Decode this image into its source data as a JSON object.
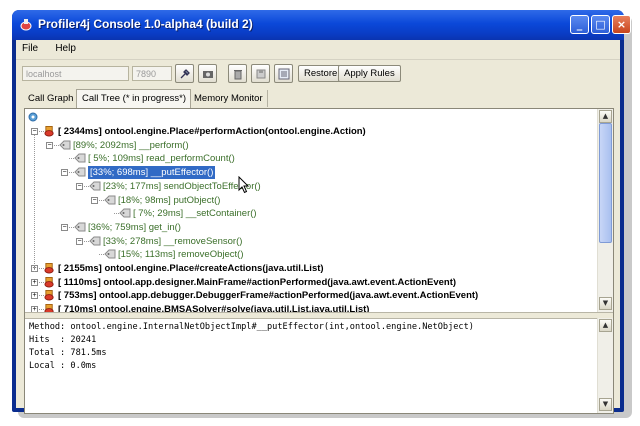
{
  "window": {
    "title": "Profiler4j Console 1.0-alpha4 (build 2)",
    "minimize": "_",
    "maximize": "□",
    "close": "×"
  },
  "menu": [
    "File",
    "Help"
  ],
  "toolbar": {
    "host_placeholder": "localhost",
    "port_placeholder": "7890",
    "restore_label": "Restore",
    "apply_rules_label": "Apply Rules"
  },
  "tabs": [
    {
      "label": "Call Graph",
      "active": false
    },
    {
      "label": "Call Tree (* in progress*)",
      "active": true
    },
    {
      "label": "Memory Monitor",
      "active": false
    }
  ],
  "tree": [
    {
      "depth": 0,
      "icon": "method-icon",
      "text": "[  2344ms] ontool.engine.Place#performAction(ontool.engine.Action)",
      "style": "bold"
    },
    {
      "depth": 1,
      "icon": "method-icon",
      "text": "[89%;   2092ms] __perform()",
      "style": "green"
    },
    {
      "depth": 2,
      "icon": "method-icon",
      "text": "[ 5%;   109ms] read_performCount()",
      "style": "green"
    },
    {
      "depth": 2,
      "icon": "method-icon",
      "text": "[33%;   698ms] __putEffector()",
      "style": "selected"
    },
    {
      "depth": 3,
      "icon": "method-icon",
      "text": "[23%;   177ms] sendObjectToEffector()",
      "style": "green"
    },
    {
      "depth": 4,
      "icon": "method-icon",
      "text": "[18%;    98ms] putObject()",
      "style": "green"
    },
    {
      "depth": 5,
      "icon": "method-icon",
      "text": "[ 7%;    29ms] __setContainer()",
      "style": "green"
    },
    {
      "depth": 2,
      "icon": "method-icon",
      "text": "[36%;   759ms] get_in()",
      "style": "green"
    },
    {
      "depth": 3,
      "icon": "method-icon",
      "text": "[33%;   278ms] __removeSensor()",
      "style": "green"
    },
    {
      "depth": 4,
      "icon": "method-icon",
      "text": "[15%;   113ms] removeObject()",
      "style": "green"
    },
    {
      "depth": 0,
      "icon": "method-icon",
      "text": "[  2155ms] ontool.engine.Place#createActions(java.util.List)",
      "style": "bold"
    },
    {
      "depth": 0,
      "icon": "method-icon",
      "text": "[  1110ms] ontool.app.designer.MainFrame#actionPerformed(java.awt.event.ActionEvent)",
      "style": "bold"
    },
    {
      "depth": 0,
      "icon": "method-icon",
      "text": "[   753ms] ontool.app.debugger.DebuggerFrame#actionPerformed(java.awt.event.ActionEvent)",
      "style": "bold"
    },
    {
      "depth": 0,
      "icon": "method-icon",
      "text": "[   710ms] ontool.engine.BMSASolver#solve(java.util.List,java.util.List)",
      "style": "bold"
    }
  ],
  "details": {
    "method": "Method: ontool.engine.InternalNetObjectImpl#__putEffector(int,ontool.engine.NetObject)",
    "hits": "Hits  : 20241",
    "total": "Total : 781.5ms",
    "local": "Local : 0.0ms"
  },
  "colors": {
    "title_bar": "#0b48d9",
    "selection": "#316ac5",
    "child_text": "#3b6f2a"
  }
}
